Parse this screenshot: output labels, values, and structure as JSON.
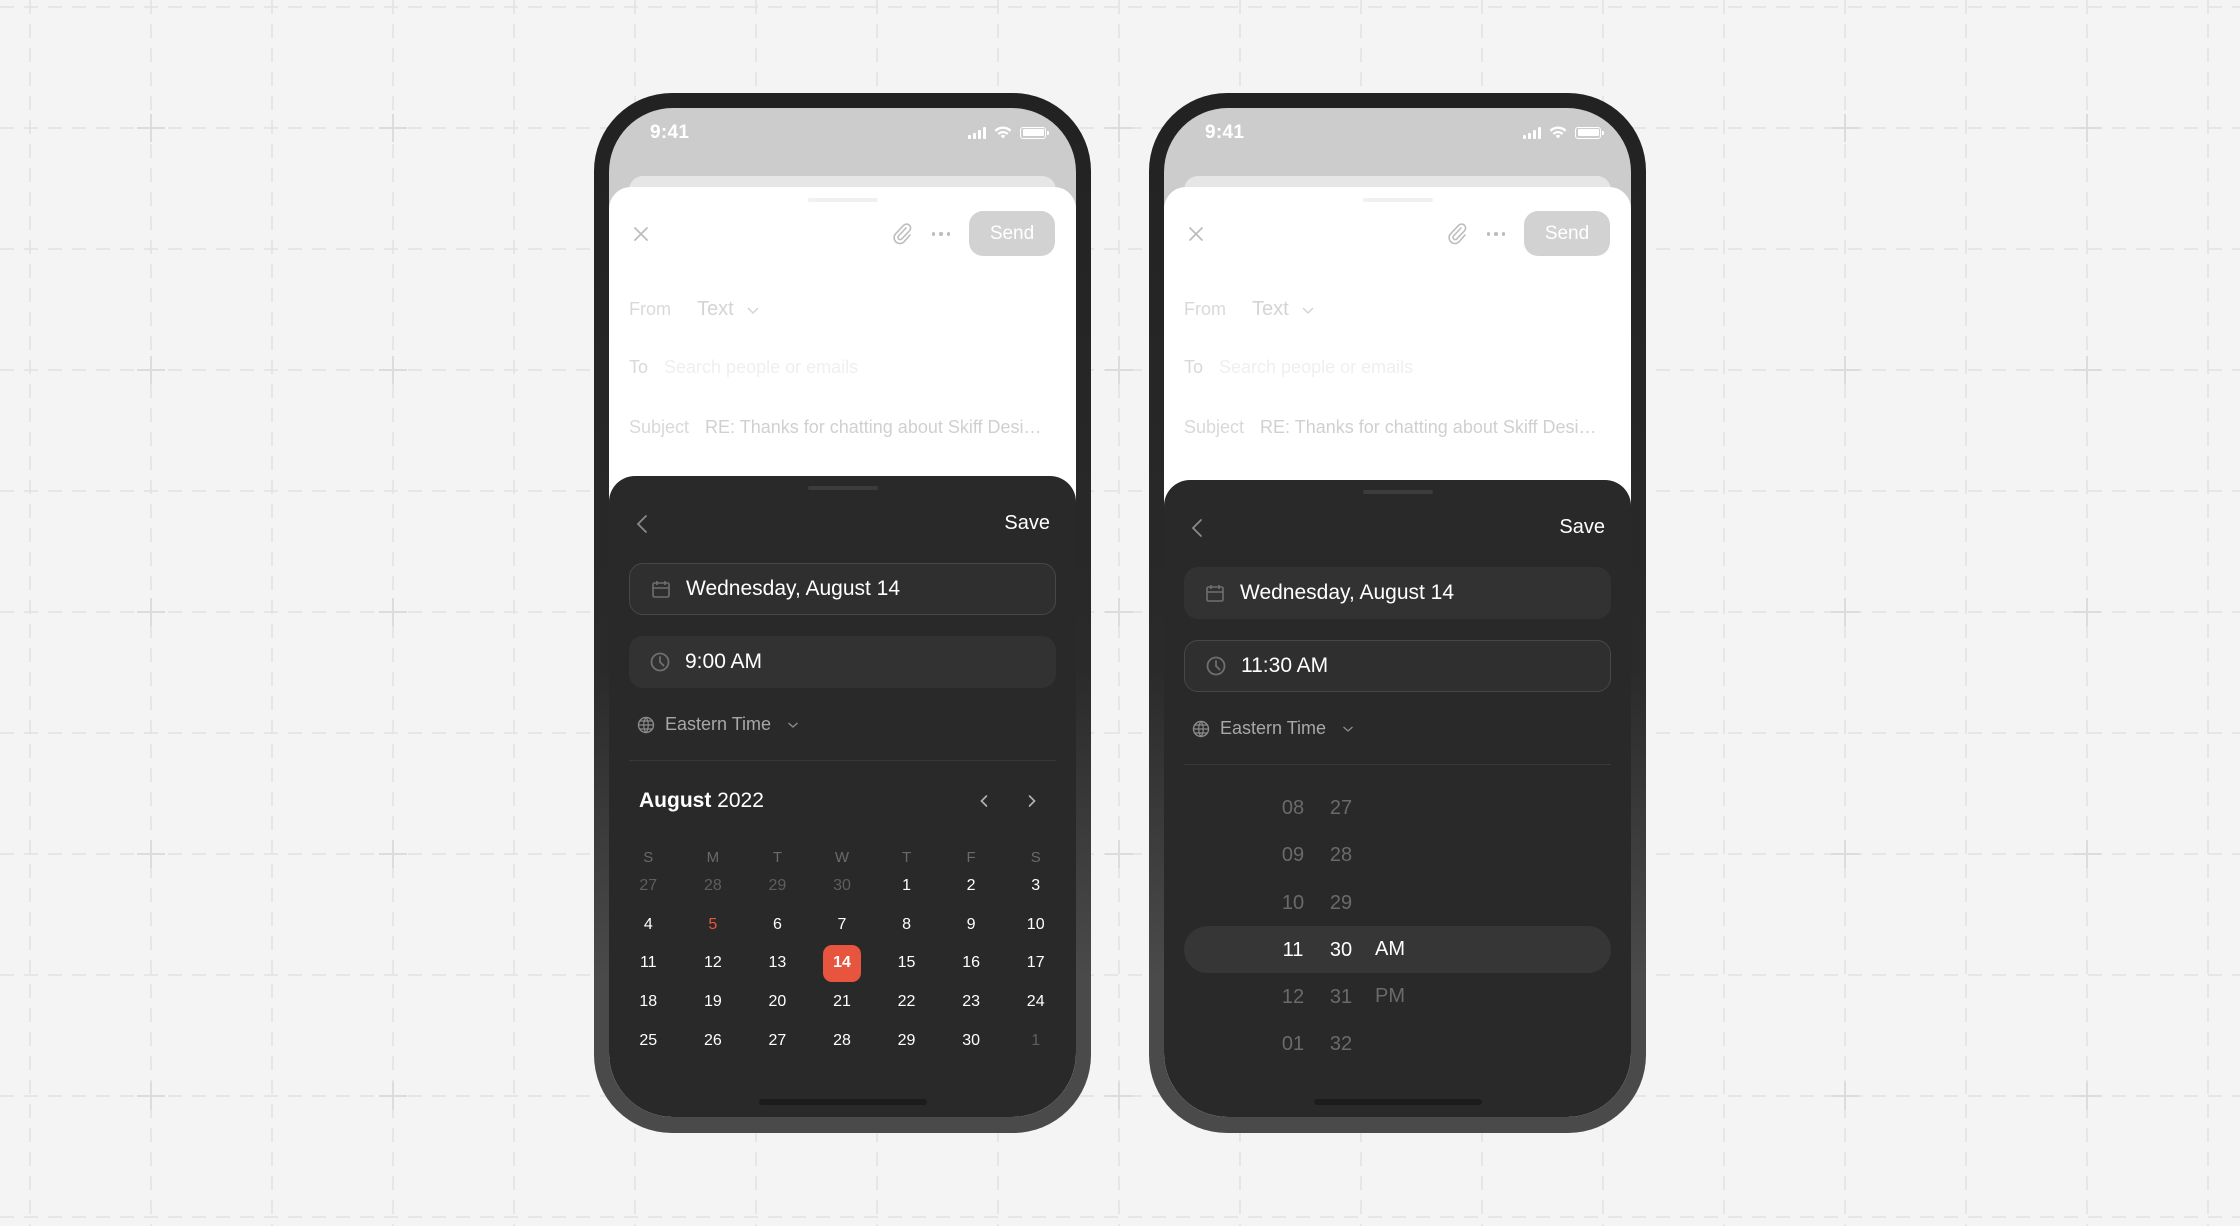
{
  "phones": [
    {
      "status_bar": {
        "time": "9:41"
      },
      "compose": {
        "close_icon": "close-icon",
        "attach_icon": "paperclip-icon",
        "more_icon": "more-horizontal-icon",
        "send_label": "Send",
        "from_label": "From",
        "from_value": "Text",
        "to_label": "To",
        "to_placeholder": "Search people or emails",
        "subject_label": "Subject",
        "subject_value": "RE: Thanks for chatting about Skiff Desi…"
      },
      "picker": {
        "save_label": "Save",
        "date_value": "Wednesday, August 14",
        "time_value": "9:00 AM",
        "timezone": "Eastern Time",
        "active_field": "date",
        "calendar": {
          "month": "August",
          "year": "2022",
          "weekdays": [
            "S",
            "M",
            "T",
            "W",
            "T",
            "F",
            "S"
          ],
          "days": [
            {
              "d": "27",
              "muted": true
            },
            {
              "d": "28",
              "muted": true
            },
            {
              "d": "29",
              "muted": true
            },
            {
              "d": "30",
              "muted": true
            },
            {
              "d": "1"
            },
            {
              "d": "2"
            },
            {
              "d": "3"
            },
            {
              "d": "4"
            },
            {
              "d": "5",
              "today": true
            },
            {
              "d": "6"
            },
            {
              "d": "7"
            },
            {
              "d": "8"
            },
            {
              "d": "9"
            },
            {
              "d": "10"
            },
            {
              "d": "11"
            },
            {
              "d": "12"
            },
            {
              "d": "13"
            },
            {
              "d": "14",
              "selected": true
            },
            {
              "d": "15"
            },
            {
              "d": "16"
            },
            {
              "d": "17"
            },
            {
              "d": "18"
            },
            {
              "d": "19"
            },
            {
              "d": "20"
            },
            {
              "d": "21"
            },
            {
              "d": "22"
            },
            {
              "d": "23"
            },
            {
              "d": "24"
            },
            {
              "d": "25"
            },
            {
              "d": "26"
            },
            {
              "d": "27"
            },
            {
              "d": "28"
            },
            {
              "d": "29"
            },
            {
              "d": "30"
            },
            {
              "d": "1",
              "muted": true
            }
          ]
        }
      }
    },
    {
      "status_bar": {
        "time": "9:41"
      },
      "compose": {
        "close_icon": "close-icon",
        "attach_icon": "paperclip-icon",
        "more_icon": "more-horizontal-icon",
        "send_label": "Send",
        "from_label": "From",
        "from_value": "Text",
        "to_label": "To",
        "to_placeholder": "Search people or emails",
        "subject_label": "Subject",
        "subject_value": "RE: Thanks for chatting about Skiff Desi…"
      },
      "picker": {
        "save_label": "Save",
        "date_value": "Wednesday, August 14",
        "time_value": "11:30 AM",
        "timezone": "Eastern Time",
        "active_field": "time",
        "wheel": {
          "hours": [
            "08",
            "09",
            "10",
            "11",
            "12",
            "01"
          ],
          "minutes": [
            "27",
            "28",
            "29",
            "30",
            "31",
            "32"
          ],
          "periods": [
            "AM",
            "PM"
          ],
          "selected": {
            "hour": "11",
            "minute": "30",
            "period": "AM"
          }
        }
      }
    }
  ],
  "colors": {
    "accent": "#e8553e",
    "sheet_bg": "#292929",
    "page_bg": "#f4f4f4"
  }
}
